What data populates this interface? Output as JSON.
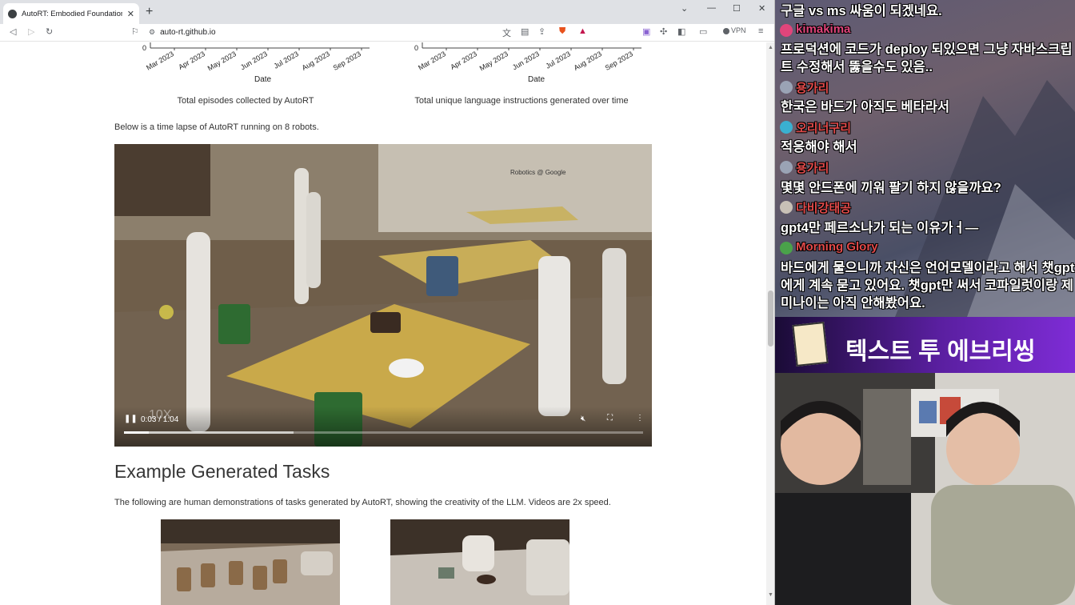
{
  "browser": {
    "tab_title": "AutoRT: Embodied Foundation M",
    "url": "auto-rt.github.io",
    "vpn_label": "VPN"
  },
  "page": {
    "chart_left": {
      "x_ticks": [
        "Mar 2023",
        "Apr 2023",
        "May 2023",
        "Jun 2023",
        "Jul 2023",
        "Aug 2023",
        "Sep 2023"
      ],
      "y_tick": "0",
      "xlabel": "Date",
      "caption": "Total episodes collected by AutoRT"
    },
    "chart_right": {
      "x_ticks": [
        "Mar 2023",
        "Apr 2023",
        "May 2023",
        "Jun 2023",
        "Jul 2023",
        "Aug 2023",
        "Sep 2023"
      ],
      "y_tick": "0",
      "xlabel": "Date",
      "caption": "Total unique language instructions generated over time"
    },
    "timelapse_text": "Below is a time lapse of AutoRT running on 8 robots.",
    "video": {
      "time": "0:03 / 1:04",
      "watermark": "10X",
      "scene_text": "Robotics @ Google",
      "progress_fraction": 0.047,
      "buffered_fraction": 0.326
    },
    "section_title": "Example Generated Tasks",
    "section_text": "The following are human demonstrations of tasks generated by AutoRT, showing the creativity of the LLM. Videos are 2x speed."
  },
  "stream": {
    "chat": [
      {
        "text": "구글 vs ms 싸움이 되겠네요."
      },
      {
        "name": "kimakima",
        "name_color": "#e0457b",
        "text": "프로덕션에 코드가 deploy 되있으면 그냥 자바스크립",
        "text2": "트 수정해서 뚫을수도 있음.."
      },
      {
        "name": "용가리",
        "name_color": "#e24a4a",
        "text": "한국은 바드가 아직도 베타라서"
      },
      {
        "name": "오리너구리",
        "name_color": "#e24a4a",
        "text": "적응해야 해서"
      },
      {
        "name": "용가리",
        "name_color": "#e24a4a",
        "text": "몇몇 안드폰에 끼워 팔기 하지 않을까요?"
      },
      {
        "name": "다비강태공",
        "name_color": "#e24a4a",
        "text": "gpt4만 페르소나가 되는 이유가ㅓ—"
      },
      {
        "name": "Morning Glory",
        "name_color": "#e24a4a",
        "text": "바드에게 물으니까 자신은 언어모델이라고 해서 챗gpt",
        "text2": "에게 계속 묻고 있어요. 챗gpt만 써서 코파일럿이랑 제",
        "text3": "미나이는 아직 안해봤어요."
      }
    ],
    "banner_text": "텍스트 투 에브리씽"
  }
}
